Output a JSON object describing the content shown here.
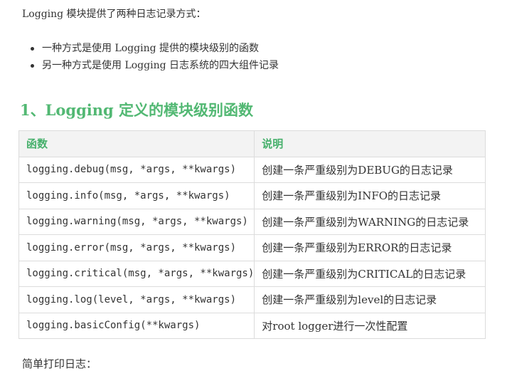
{
  "intro": "Logging 模块提供了两种日志记录方式：",
  "bullets": [
    "一种方式是使用 Logging 提供的模块级别的函数",
    "另一种方式是使用 Logging 日志系统的四大组件记录"
  ],
  "section_title": "1、Logging 定义的模块级别函数",
  "table": {
    "headers": [
      "函数",
      "说明"
    ],
    "rows": [
      [
        "logging.debug(msg, *args, **kwargs)",
        "创建一条严重级别为DEBUG的日志记录"
      ],
      [
        "logging.info(msg, *args, **kwargs)",
        "创建一条严重级别为INFO的日志记录"
      ],
      [
        "logging.warning(msg, *args, **kwargs)",
        "创建一条严重级别为WARNING的日志记录"
      ],
      [
        "logging.error(msg, *args, **kwargs)",
        "创建一条严重级别为ERROR的日志记录"
      ],
      [
        "logging.critical(msg, *args, **kwargs)",
        "创建一条严重级别为CRITICAL的日志记录"
      ],
      [
        "logging.log(level, *args, **kwargs)",
        "创建一条严重级别为level的日志记录"
      ],
      [
        "logging.basicConfig(**kwargs)",
        "对root logger进行一次性配置"
      ]
    ]
  },
  "outro": "简单打印日志：",
  "colors": {
    "heading_green": "#52b873",
    "header_bg": "#f3f3f3",
    "border": "#dcdcdc",
    "text": "#333333"
  }
}
